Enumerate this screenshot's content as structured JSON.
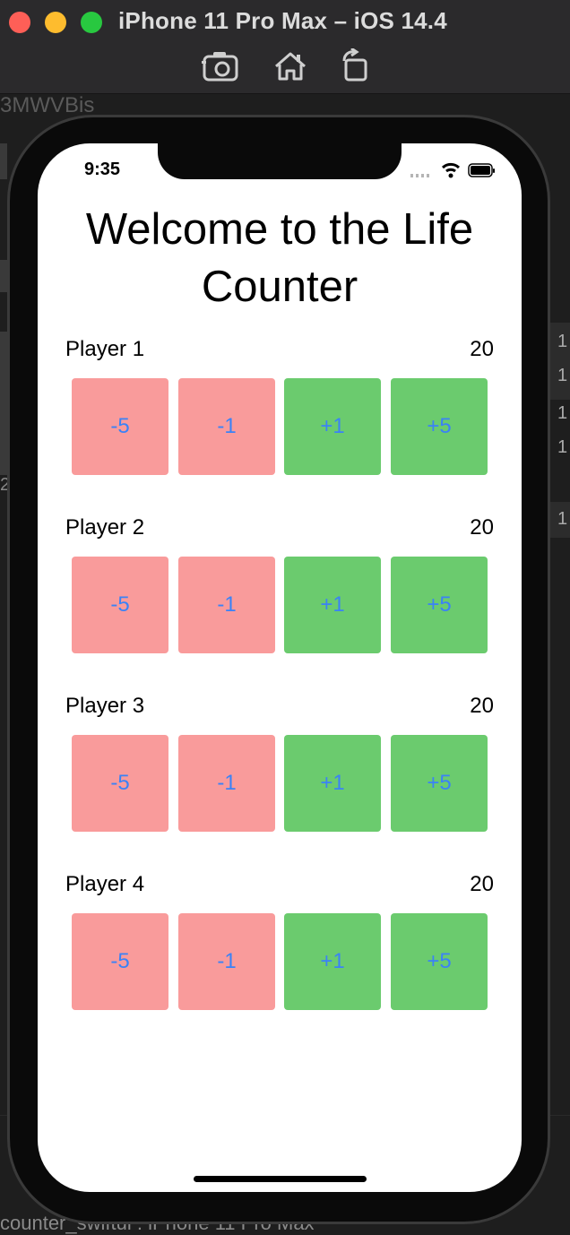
{
  "window": {
    "title": "iPhone 11 Pro Max – iOS 14.4",
    "toolbar": {
      "icons": [
        "screenshot-icon",
        "home-icon",
        "rotate-icon"
      ]
    }
  },
  "background": {
    "top_fragment": "3MWVBis",
    "bottom_fragment": "counter_swiftui : iPhone 11 Pro Max",
    "right_digits": [
      "1",
      "1",
      "1",
      "1",
      "1"
    ],
    "left_digit": "2"
  },
  "status_bar": {
    "time": "9:35",
    "icons": [
      "signal-icon",
      "wifi-icon",
      "battery-icon"
    ]
  },
  "app": {
    "title": "Welcome to the Life Counter",
    "players": [
      {
        "name": "Player 1",
        "life": "20",
        "buttons": [
          "-5",
          "-1",
          "+1",
          "+5"
        ]
      },
      {
        "name": "Player 2",
        "life": "20",
        "buttons": [
          "-5",
          "-1",
          "+1",
          "+5"
        ]
      },
      {
        "name": "Player 3",
        "life": "20",
        "buttons": [
          "-5",
          "-1",
          "+1",
          "+5"
        ]
      },
      {
        "name": "Player 4",
        "life": "20",
        "buttons": [
          "-5",
          "-1",
          "+1",
          "+5"
        ]
      }
    ]
  },
  "colors": {
    "decrement_button": "#f99b9b",
    "increment_button": "#6bcb6e",
    "button_text": "#3b82f6"
  }
}
